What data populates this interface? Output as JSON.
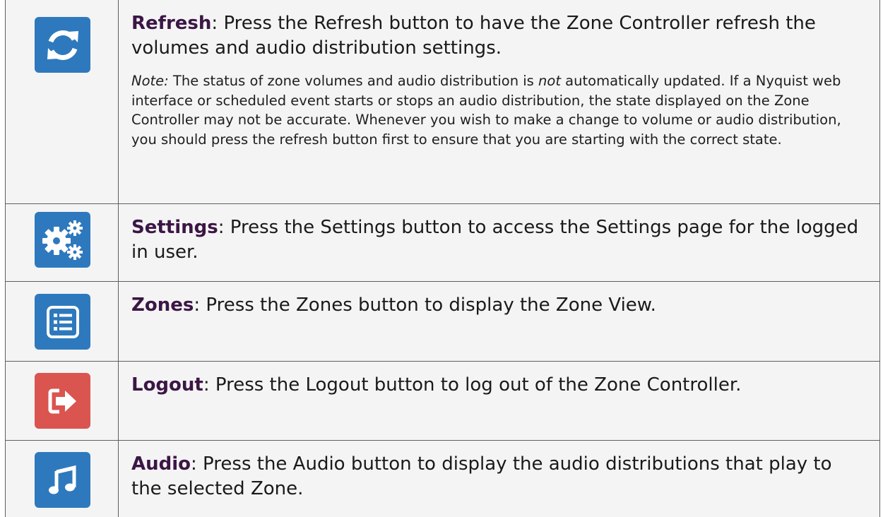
{
  "rows": [
    {
      "name": "refresh",
      "icon": "refresh-icon",
      "term": "Refresh",
      "text": ": Press the Refresh button to have the Zone Controller refresh the volumes and audio distribution settings.",
      "note_label": "Note:",
      "note_pre": " The status of zone volumes and audio distribution is ",
      "note_em": "not",
      "note_post": " automatically updated. If a Nyquist web interface or scheduled event starts or stops an audio distribution, the state displayed on the Zone Controller may not be accurate. Whenever you wish to make a change to volume or audio distribution, you should press the refresh button first to ensure that you are starting with the correct state."
    },
    {
      "name": "settings",
      "icon": "gears-icon",
      "term": "Settings",
      "text": ": Press the Settings button to access the Settings page for the logged in user."
    },
    {
      "name": "zones",
      "icon": "list-icon",
      "term": "Zones",
      "text": ": Press the Zones button to display the Zone View."
    },
    {
      "name": "logout",
      "icon": "logout-icon",
      "term": "Logout",
      "text": ": Press the Logout button to log out of the Zone Controller."
    },
    {
      "name": "audio",
      "icon": "music-note-icon",
      "term": "Audio",
      "text": ": Press the Audio button to display the audio distributions that play to the selected Zone."
    }
  ],
  "colors": {
    "blue_button": "#2e79bd",
    "red_button": "#da5450",
    "term_color": "#3b1645",
    "row_bg": "#f4f4f4",
    "border": "#5f5f5f"
  }
}
